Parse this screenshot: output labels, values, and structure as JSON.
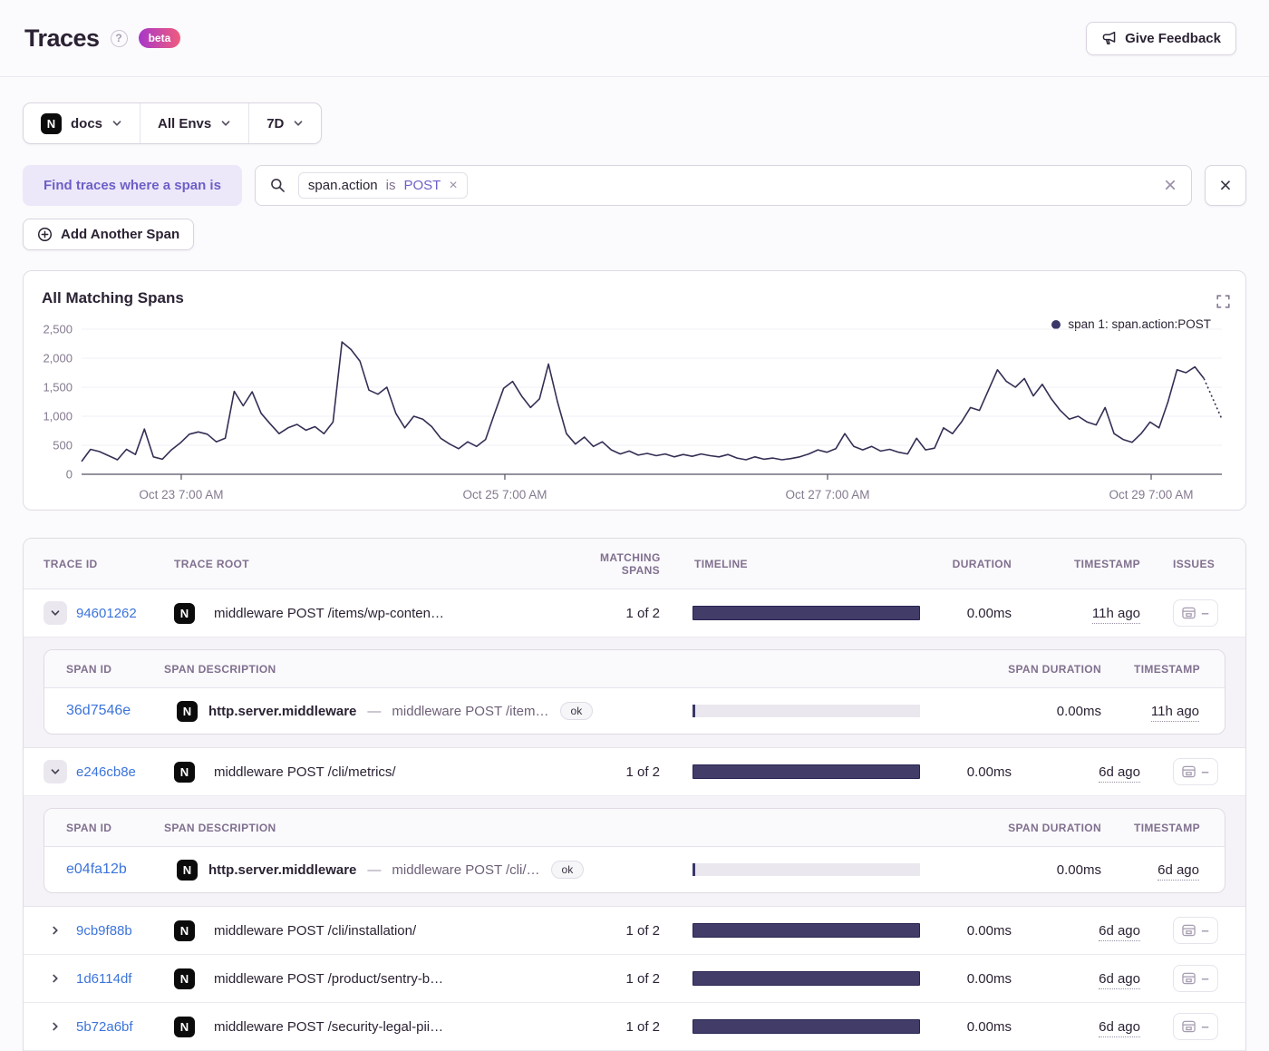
{
  "page": {
    "title": "Traces",
    "beta_label": "beta",
    "feedback_label": "Give Feedback"
  },
  "filters": {
    "project": {
      "label": "docs",
      "icon": "nextjs"
    },
    "environment": {
      "label": "All Envs"
    },
    "period": {
      "label": "7D"
    }
  },
  "search": {
    "span_label": "Find traces where a span is",
    "token": {
      "key": "span.action",
      "op": "is",
      "value": "POST",
      "remove": "×"
    },
    "clear": "×",
    "close": "×",
    "add_span_label": "Add Another Span"
  },
  "chart_data": {
    "type": "line",
    "title": "All Matching Spans",
    "legend_position": "top-right",
    "xlabel": "",
    "ylabel": "",
    "ylim": [
      0,
      2500
    ],
    "grid": true,
    "y_ticks": [
      0,
      500,
      1000,
      1500,
      2000,
      2500
    ],
    "y_tick_labels": [
      "0",
      "500",
      "1,000",
      "1,500",
      "2,000",
      "2,500"
    ],
    "x_tick_labels": [
      "Oct 23 7:00 AM",
      "Oct 25 7:00 AM",
      "Oct 27 7:00 AM",
      "Oct 29 7:00 AM"
    ],
    "x_tick_fractions": [
      0.0874,
      0.3712,
      0.6542,
      0.938
    ],
    "series": [
      {
        "name": "span 1: span.action:POST",
        "color": "#332f54",
        "values": [
          220,
          430,
          390,
          320,
          250,
          430,
          340,
          780,
          300,
          260,
          420,
          540,
          690,
          730,
          690,
          560,
          620,
          1430,
          1180,
          1420,
          1050,
          870,
          700,
          800,
          860,
          760,
          820,
          700,
          900,
          2280,
          2150,
          1950,
          1450,
          1380,
          1500,
          1050,
          800,
          1000,
          950,
          820,
          620,
          520,
          440,
          560,
          480,
          600,
          1050,
          1480,
          1600,
          1350,
          1150,
          1300,
          1900,
          1250,
          700,
          520,
          640,
          480,
          560,
          420,
          350,
          400,
          330,
          360,
          320,
          350,
          300,
          340,
          310,
          350,
          320,
          300,
          340,
          280,
          250,
          300,
          260,
          280,
          250,
          270,
          300,
          350,
          420,
          380,
          440,
          700,
          480,
          420,
          480,
          400,
          430,
          380,
          350,
          620,
          420,
          450,
          800,
          700,
          900,
          1150,
          1100,
          1450,
          1800,
          1600,
          1500,
          1650,
          1350,
          1550,
          1300,
          1100,
          950,
          1000,
          900,
          850,
          1150,
          700,
          600,
          550,
          700,
          900,
          800,
          1250,
          1800,
          1750,
          1850,
          1650
        ],
        "dashed_tail": [
          1300,
          950
        ]
      }
    ]
  },
  "table": {
    "columns": [
      "TRACE ID",
      "TRACE ROOT",
      "MATCHING SPANS",
      "TIMELINE",
      "DURATION",
      "TIMESTAMP",
      "ISSUES"
    ],
    "sub_columns": [
      "SPAN ID",
      "SPAN DESCRIPTION",
      "",
      "SPAN DURATION",
      "TIMESTAMP"
    ],
    "desc_separator": "—",
    "issues_placeholder": "–",
    "rows": [
      {
        "id": "94601262",
        "expanded": true,
        "root": "middleware POST /items/wp-conten…",
        "matching": "1 of 2",
        "duration": "0.00ms",
        "timestamp": "11h ago",
        "spans": [
          {
            "id": "36d7546e",
            "op": "http.server.middleware",
            "description": "middleware POST /item…",
            "status": "ok",
            "duration": "0.00ms",
            "timestamp": "11h ago"
          }
        ]
      },
      {
        "id": "e246cb8e",
        "expanded": true,
        "root": "middleware POST /cli/metrics/",
        "matching": "1 of 2",
        "duration": "0.00ms",
        "timestamp": "6d ago",
        "spans": [
          {
            "id": "e04fa12b",
            "op": "http.server.middleware",
            "description": "middleware POST /cli/…",
            "status": "ok",
            "duration": "0.00ms",
            "timestamp": "6d ago"
          }
        ]
      },
      {
        "id": "9cb9f88b",
        "expanded": false,
        "root": "middleware POST /cli/installation/",
        "matching": "1 of 2",
        "duration": "0.00ms",
        "timestamp": "6d ago"
      },
      {
        "id": "1d6114df",
        "expanded": false,
        "root": "middleware POST /product/sentry-b…",
        "matching": "1 of 2",
        "duration": "0.00ms",
        "timestamp": "6d ago"
      },
      {
        "id": "5b72a6bf",
        "expanded": false,
        "root": "middleware POST /security-legal-pii…",
        "matching": "1 of 2",
        "duration": "0.00ms",
        "timestamp": "6d ago"
      }
    ]
  }
}
